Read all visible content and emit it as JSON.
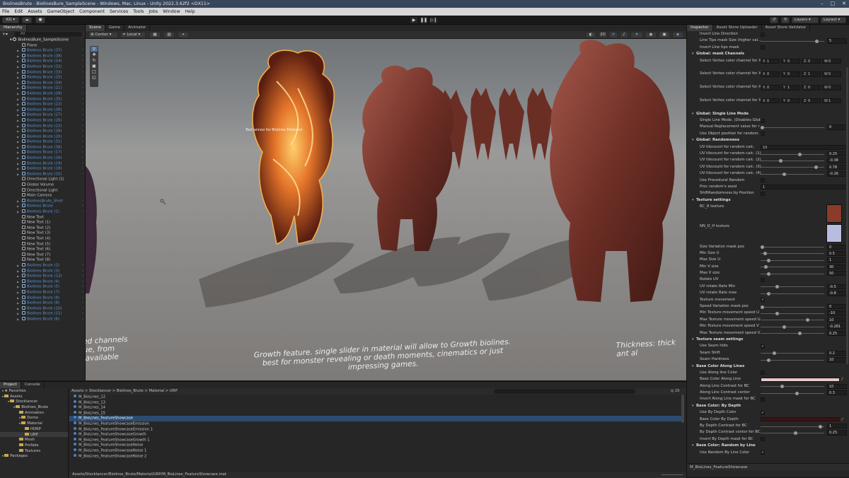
{
  "window": {
    "title": "BiolinesBrute - BiolinesBure_SampleScene - Windows, Mac, Linux - Unity 2022.3.62f2 <DX11>"
  },
  "menu": [
    "File",
    "Edit",
    "Assets",
    "GameObject",
    "Component",
    "Services",
    "Tools",
    "Jobs",
    "Window",
    "Help"
  ],
  "toolbar": {
    "account": "KD",
    "layers": "Layers",
    "layout": "Layout"
  },
  "hierarchy": {
    "tab": "Hierarchy",
    "search": "All",
    "scene": "BiolinesBure_SampleScene",
    "items": [
      {
        "label": "Plane",
        "blue": false
      },
      {
        "label": "Biolines Brute (37)",
        "blue": true
      },
      {
        "label": "Biolines Brute (38)",
        "blue": true
      },
      {
        "label": "Biolines Brute (24)",
        "blue": true
      },
      {
        "label": "Biolines Brute (32)",
        "blue": true
      },
      {
        "label": "Biolines Brute (33)",
        "blue": true
      },
      {
        "label": "Biolines Brute (25)",
        "blue": true
      },
      {
        "label": "Biolines Brute (34)",
        "blue": true
      },
      {
        "label": "Biolines Brute (21)",
        "blue": true
      },
      {
        "label": "Biolines Brute (28)",
        "blue": true
      },
      {
        "label": "Biolines Brute (35)",
        "blue": true
      },
      {
        "label": "Biolines Brute (22)",
        "blue": true
      },
      {
        "label": "Biolines Brute (30)",
        "blue": true
      },
      {
        "label": "Biolines Brute (27)",
        "blue": true
      },
      {
        "label": "Biolines Brute (26)",
        "blue": true
      },
      {
        "label": "Biolines Brute (23)",
        "blue": true
      },
      {
        "label": "Biolines Brute (28)",
        "blue": true
      },
      {
        "label": "Biolines Brute (20)",
        "blue": true
      },
      {
        "label": "Biolines Brute (31)",
        "blue": true
      },
      {
        "label": "Biolines Brute (36)",
        "blue": true
      },
      {
        "label": "Biolines Brute (17)",
        "blue": true
      },
      {
        "label": "Biolines Brute (16)",
        "blue": true
      },
      {
        "label": "Biolines Brute (19)",
        "blue": true
      },
      {
        "label": "Biolines Brute (18)",
        "blue": true
      },
      {
        "label": "Biolines Brute (15)",
        "blue": true
      },
      {
        "label": "Directional Light (1)",
        "blue": false
      },
      {
        "label": "Global Volume",
        "blue": false
      },
      {
        "label": "Directional Light",
        "blue": false
      },
      {
        "label": "Main Camera",
        "blue": false
      },
      {
        "label": "BiolinesBrute_Shell",
        "blue": true
      },
      {
        "label": "Biolines Brute",
        "blue": true
      },
      {
        "label": "Biolines Brute (1)",
        "blue": true
      },
      {
        "label": "New Text",
        "blue": false
      },
      {
        "label": "New Text (1)",
        "blue": false
      },
      {
        "label": "New Text (2)",
        "blue": false
      },
      {
        "label": "New Text (3)",
        "blue": false
      },
      {
        "label": "New Text (4)",
        "blue": false
      },
      {
        "label": "New Text (5)",
        "blue": false
      },
      {
        "label": "New Text (6)",
        "blue": false
      },
      {
        "label": "New Text (7)",
        "blue": false
      },
      {
        "label": "New Text (8)",
        "blue": false
      },
      {
        "label": "Biolines Brute (2)",
        "blue": true
      },
      {
        "label": "Biolines Brute (3)",
        "blue": true
      },
      {
        "label": "Biolines Brute (12)",
        "blue": true
      },
      {
        "label": "Biolines Brute (4)",
        "blue": true
      },
      {
        "label": "Biolines Brute (5)",
        "blue": true
      },
      {
        "label": "Biolines Brute (7)",
        "blue": true
      },
      {
        "label": "Biolines Brute (9)",
        "blue": true
      },
      {
        "label": "Biolines Brute (8)",
        "blue": true
      },
      {
        "label": "Biolines Brute (10)",
        "blue": true
      },
      {
        "label": "Biolines Brute (11)",
        "blue": true
      },
      {
        "label": "Biolines Brute (6)",
        "blue": true
      }
    ]
  },
  "scene_view": {
    "tabs": [
      "Scene",
      "Game",
      "Animator"
    ],
    "pivot": "Center",
    "space": "Local",
    "mode2d": "2D",
    "overlay_texts": {
      "left": "ded channels\nhue, from\ns available",
      "center": "Growth feature. single slider in material will allow to Growth biolines.\nbest for monster revealing or death moments, cinematics or just\nimpressing games.",
      "right": "Thickness: thick\nant al",
      "small": "Text annoo for Biolines Emission"
    }
  },
  "inspector": {
    "tabs": [
      "Inspector",
      "Asset Store Uploader",
      "Asset Store Validator"
    ],
    "rows": [
      {
        "t": "check",
        "label": "Invert Line Direction",
        "on": false
      },
      {
        "t": "slider",
        "label": "Line Tips mask Size (higher val...",
        "value": "5",
        "pos": 0.9
      },
      {
        "t": "check",
        "label": "Invert Line tips mask",
        "on": false
      },
      {
        "t": "hdr",
        "label": "Global: mask Channels"
      },
      {
        "t": "vec",
        "label": "Select Vertex color channel for X",
        "v": [
          "1",
          "0",
          "0",
          "0"
        ]
      },
      {
        "t": "gap"
      },
      {
        "t": "vec",
        "label": "Select Vertex color channel for X",
        "v": [
          "0",
          "0",
          "1",
          "0"
        ]
      },
      {
        "t": "gap"
      },
      {
        "t": "vec",
        "label": "Select Vertex color channel for X",
        "v": [
          "0",
          "1",
          "0",
          "0"
        ]
      },
      {
        "t": "gap"
      },
      {
        "t": "vec",
        "label": "Select Vertex color channel for X",
        "v": [
          "0",
          "0",
          "0",
          "1"
        ]
      },
      {
        "t": "gap"
      },
      {
        "t": "hdr",
        "label": "Global: Single Line Mode"
      },
      {
        "t": "check",
        "label": "Single Line Mode. (Disables Glob...",
        "on": false
      },
      {
        "t": "slider",
        "label": "Manual Replacement value for r",
        "value": "0",
        "pos": 0.0
      },
      {
        "t": "check",
        "label": "Use Object position for random ...",
        "on": false
      },
      {
        "t": "hdr",
        "label": "Global: Randomness"
      },
      {
        "t": "field",
        "label": "UV tilecount for random calc.",
        "value": "10"
      },
      {
        "t": "slider",
        "label": "UV tilecount for random calc. (1)",
        "value": "0.25",
        "pos": 0.62
      },
      {
        "t": "slider",
        "label": "UV tilecount for random calc. (2)",
        "value": "-0.38",
        "pos": 0.31
      },
      {
        "t": "slider",
        "label": "UV tilecount for random calc. (3)",
        "value": "0.78",
        "pos": 0.89
      },
      {
        "t": "slider",
        "label": "UV tilecount for random calc. (4)",
        "value": "-0.26",
        "pos": 0.37
      },
      {
        "t": "check",
        "label": "Use Procedural Random",
        "on": false
      },
      {
        "t": "field",
        "label": "Proc random's seed",
        "value": "1"
      },
      {
        "t": "check",
        "label": "ShiftRandomness by Position",
        "on": false
      },
      {
        "t": "hdr",
        "label": "Texture settings"
      },
      {
        "t": "tex",
        "label": "BC_R texture",
        "color": "#8a3b2a"
      },
      {
        "t": "gap"
      },
      {
        "t": "gap"
      },
      {
        "t": "tex",
        "label": "NN_D_H texture",
        "color": "#b8bde0"
      },
      {
        "t": "gap"
      },
      {
        "t": "gap"
      },
      {
        "t": "slider",
        "label": "Size Variation mask pos",
        "value": "0",
        "pos": 0.0
      },
      {
        "t": "slider",
        "label": "Min Size U",
        "value": "0.5",
        "pos": 0.05
      },
      {
        "t": "slider",
        "label": "Max Size U",
        "value": "1",
        "pos": 0.1
      },
      {
        "t": "slider",
        "label": "Min V size",
        "value": "30",
        "pos": 0.06
      },
      {
        "t": "slider",
        "label": "Max V size",
        "value": "50",
        "pos": 0.1
      },
      {
        "t": "check",
        "label": "Rotate UV",
        "on": false
      },
      {
        "t": "slider",
        "label": "UV rotate Rate Min",
        "value": "-0.5",
        "pos": 0.25
      },
      {
        "t": "slider",
        "label": "UV rotate Rate max",
        "value": "-0.8",
        "pos": 0.1
      },
      {
        "t": "check",
        "label": "Texture movement",
        "on": true
      },
      {
        "t": "slider",
        "label": "Speed Variation mask pos",
        "value": "0",
        "pos": 0.0
      },
      {
        "t": "slider",
        "label": "Min Texture movement speed U",
        "value": "-10",
        "pos": 0.25
      },
      {
        "t": "slider",
        "label": "Max Texture movement speed U",
        "value": "10",
        "pos": 0.75
      },
      {
        "t": "slider",
        "label": "Min Texture movement speed V",
        "value": "-0.281",
        "pos": 0.36
      },
      {
        "t": "slider",
        "label": "Max Texture movement speed V",
        "value": "0.25",
        "pos": 0.62
      },
      {
        "t": "hdr",
        "label": "Texture seam settings"
      },
      {
        "t": "check",
        "label": "Use Seam hide",
        "on": true
      },
      {
        "t": "slider",
        "label": "Seam Shift",
        "value": "0.2",
        "pos": 0.2
      },
      {
        "t": "slider",
        "label": "Seam Hardness",
        "value": "10",
        "pos": 0.1
      },
      {
        "t": "hdr",
        "label": "Base Color Along Lines"
      },
      {
        "t": "check",
        "label": "Use Along line Color",
        "on": false
      },
      {
        "t": "color",
        "label": "Base Color Along Line",
        "color": "#e8c8c8"
      },
      {
        "t": "slider",
        "label": "Along Line Contrast for BC",
        "value": "10",
        "pos": 0.33
      },
      {
        "t": "slider",
        "label": "Along Line Contrast center",
        "value": "0.3",
        "pos": 0.58
      },
      {
        "t": "check",
        "label": "Invert Along Line mask for BC",
        "on": false
      },
      {
        "t": "hdr",
        "label": "Base Color: By Depth"
      },
      {
        "t": "check",
        "label": "Use By Depth Color",
        "on": true
      },
      {
        "t": "color",
        "label": "Base Color By Depth",
        "color": "#3a1414"
      },
      {
        "t": "slider",
        "label": "By Depth Contrast for BC",
        "value": "1",
        "pos": 0.96
      },
      {
        "t": "slider",
        "label": "By Depth Contrast center for BC",
        "value": "0.25",
        "pos": 0.55
      },
      {
        "t": "check",
        "label": "Invert By Depth mask for BC",
        "on": false
      },
      {
        "t": "hdr",
        "label": "Base Color: Random by Line"
      },
      {
        "t": "check",
        "label": "Use Random By Line Color",
        "on": true
      }
    ],
    "footer": "M_BioLines_FeatureShowcase"
  },
  "project": {
    "tabs": [
      "Project",
      "Console"
    ],
    "tree": [
      {
        "label": "Favorites",
        "indent": 0,
        "folder": false,
        "star": true
      },
      {
        "label": "Assets",
        "indent": 0,
        "folder": true
      },
      {
        "label": "Stocklancer",
        "indent": 1,
        "folder": true
      },
      {
        "label": "Biolines_Brute",
        "indent": 2,
        "folder": true
      },
      {
        "label": "Animation",
        "indent": 3,
        "folder": true
      },
      {
        "label": "Demo",
        "indent": 3,
        "folder": true
      },
      {
        "label": "Material",
        "indent": 3,
        "folder": true
      },
      {
        "label": "HDRP",
        "indent": 4,
        "folder": true
      },
      {
        "label": "URP",
        "indent": 4,
        "folder": true,
        "sel": true
      },
      {
        "label": "Mesh",
        "indent": 3,
        "folder": true
      },
      {
        "label": "Prefabs",
        "indent": 3,
        "folder": true
      },
      {
        "label": "Textures",
        "indent": 3,
        "folder": true
      },
      {
        "label": "Packages",
        "indent": 0,
        "folder": true
      }
    ],
    "breadcrumb": "Assets > Stocklancer > Biolines_Brute > Material > URP",
    "count": "23",
    "files": [
      {
        "label": "M_BioLines_12"
      },
      {
        "label": "M_BioLines_13"
      },
      {
        "label": "M_BioLines_14"
      },
      {
        "label": "M_BioLines_15"
      },
      {
        "label": "M_BioLines_FeatureShowcase",
        "sel": true
      },
      {
        "label": "M_BioLines_FeatureShowcaseEmission"
      },
      {
        "label": "M_BioLines_FeatureShowcaseEmission 1"
      },
      {
        "label": "M_BioLines_FeatureShowcaseGrowth"
      },
      {
        "label": "M_BioLines_FeatureShowcaseGrowth 1"
      },
      {
        "label": "M_BioLines_FeatureShowcaseNoise"
      },
      {
        "label": "M_BioLines_FeatureShowcaseNoise 1"
      },
      {
        "label": "M_BioLines_FeatureShowcaseNoise 2"
      }
    ],
    "path": "Assets/Stocklancer/Biolines_Brute/Material/URP/M_BioLines_FeatureShowcase.mat"
  }
}
